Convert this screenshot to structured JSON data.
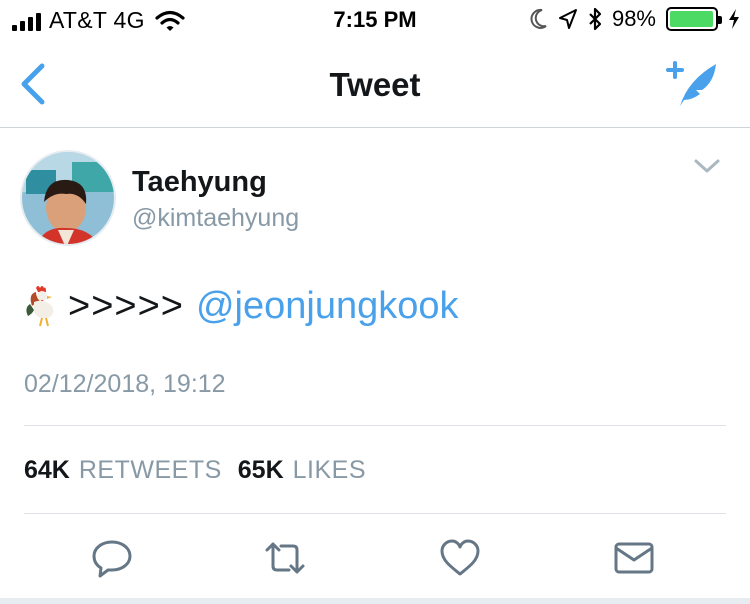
{
  "status_bar": {
    "carrier": "AT&T 4G",
    "time": "7:15 PM",
    "battery_percent": "98%",
    "battery_level": 0.98,
    "icons": [
      "signal-icon",
      "wifi-icon",
      "moon-icon",
      "location-icon",
      "bluetooth-icon",
      "battery-icon",
      "charging-icon"
    ]
  },
  "nav": {
    "title": "Tweet",
    "left_icon": "back-chevron-icon",
    "right_icon": "compose-tweet-icon"
  },
  "tweet": {
    "author_name": "Taehyung",
    "author_handle": "@kimtaehyung",
    "text_prefix_emoji": "rooster-emoji",
    "text_arrows": ">>>>>",
    "mention": "@jeonjungkook",
    "timestamp": "02/12/2018, 19:12",
    "retweets_count": "64K",
    "retweets_label": "RETWEETS",
    "likes_count": "65K",
    "likes_label": "LIKES"
  },
  "actions": [
    "reply-icon",
    "retweet-icon",
    "like-icon",
    "direct-message-icon"
  ],
  "colors": {
    "accent": "#4aa1eb",
    "secondary_text": "#8899a6",
    "battery_green": "#4cd964"
  }
}
